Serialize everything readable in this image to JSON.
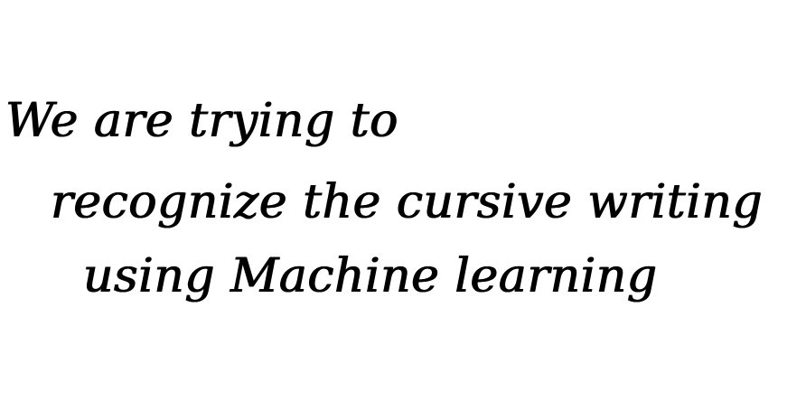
{
  "handwritten_text": {
    "lines": [
      "We are trying to",
      "recognize the cursive writing",
      "using Machine learning"
    ]
  },
  "colors": {
    "background": "#ffffff",
    "ink": "#000000"
  }
}
